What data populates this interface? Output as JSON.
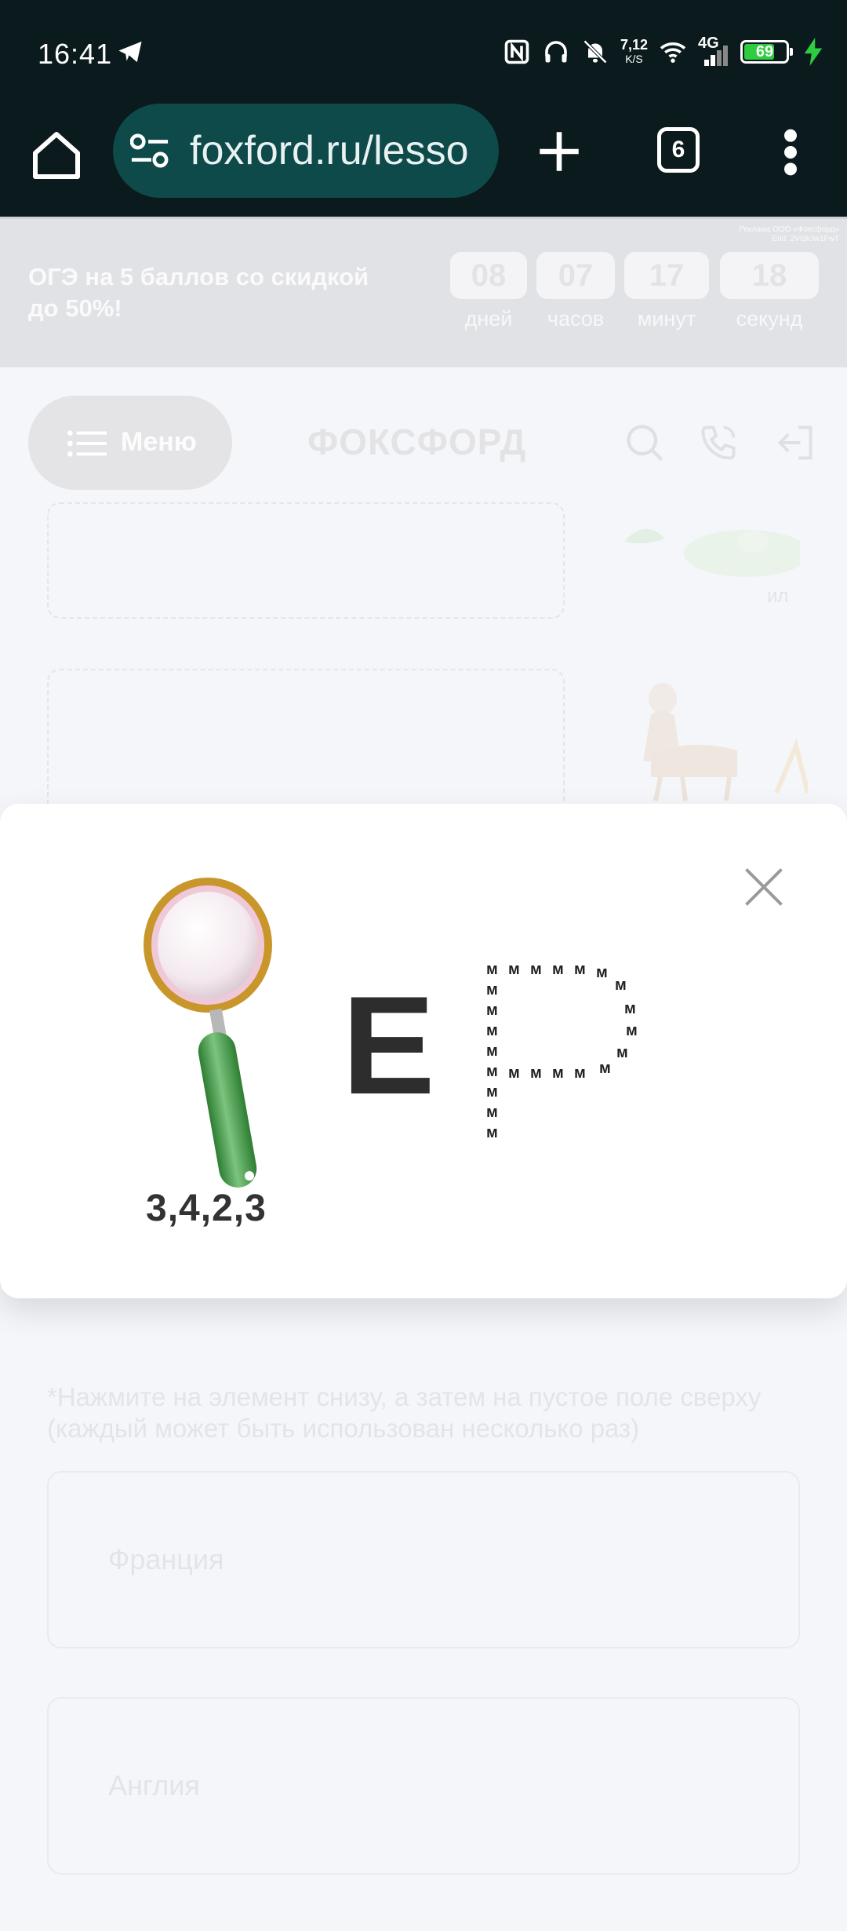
{
  "status_bar": {
    "time": "16:41",
    "net_speed": "7,12",
    "net_speed_unit": "K/S",
    "network": "4G",
    "battery": "69"
  },
  "browser": {
    "url": "foxford.ru/lesso",
    "tab_count": "6"
  },
  "promo": {
    "text": "ОГЭ на 5 баллов со скидкой до 50%!",
    "legal_line1": "Реклама ООО «Фоксфорд»",
    "legal_line2": "Erid: 2VtzkJw1FwT",
    "timer": [
      {
        "value": "08",
        "label": "дней"
      },
      {
        "value": "07",
        "label": "часов"
      },
      {
        "value": "17",
        "label": "минут"
      },
      {
        "value": "18",
        "label": "секунд"
      }
    ]
  },
  "header": {
    "menu_label": "Меню",
    "logo": "ФОКСФОРД"
  },
  "content": {
    "side_label": "ил",
    "hint": "*Нажмите на элемент снизу, а затем на пустое поле сверху (каждый может быть использован несколько раз)",
    "options": [
      "Франция",
      "Англия"
    ]
  },
  "modal": {
    "rebus_numbers": "3,4,2,3",
    "rebus_letter": "Е",
    "rebus_small_letter": "м"
  }
}
